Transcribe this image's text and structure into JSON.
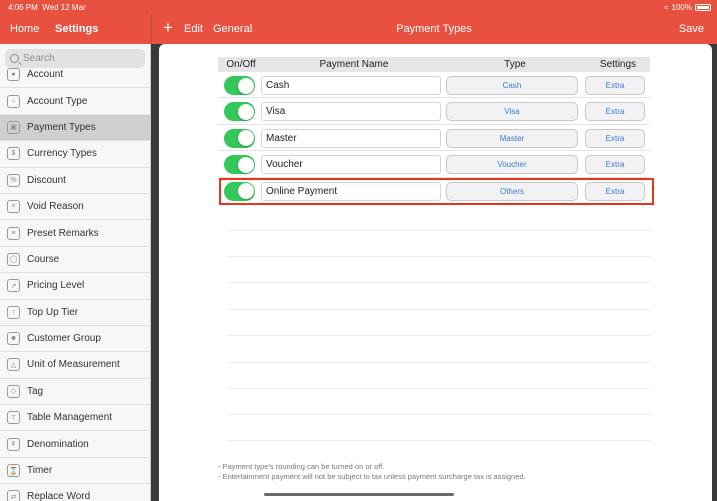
{
  "status": {
    "time": "4:06 PM",
    "date": "Wed 12 Mar",
    "battery": "100%"
  },
  "nav": {
    "home": "Home",
    "settings": "Settings",
    "add_icon": "+",
    "edit": "Edit",
    "general": "General",
    "title": "Payment Types",
    "save": "Save"
  },
  "sidebar": {
    "search_placeholder": "Search",
    "items": [
      {
        "label": "Account",
        "icon": "user-icon"
      },
      {
        "label": "Account Type",
        "icon": "account-type-icon"
      },
      {
        "label": "Payment Types",
        "icon": "wallet-icon",
        "active": true
      },
      {
        "label": "Currency Types",
        "icon": "currency-icon"
      },
      {
        "label": "Discount",
        "icon": "percent-icon"
      },
      {
        "label": "Void Reason",
        "icon": "void-icon"
      },
      {
        "label": "Preset Remarks",
        "icon": "list-icon"
      },
      {
        "label": "Course",
        "icon": "course-icon"
      },
      {
        "label": "Pricing Level",
        "icon": "price-tag-icon"
      },
      {
        "label": "Top Up Tier",
        "icon": "top-up-icon"
      },
      {
        "label": "Customer Group",
        "icon": "group-icon"
      },
      {
        "label": "Unit of Measurement",
        "icon": "measure-icon"
      },
      {
        "label": "Tag",
        "icon": "tag-icon"
      },
      {
        "label": "Table Management",
        "icon": "table-icon"
      },
      {
        "label": "Denomination",
        "icon": "coin-icon"
      },
      {
        "label": "Timer",
        "icon": "hourglass-icon"
      },
      {
        "label": "Replace Word",
        "icon": "replace-icon"
      }
    ]
  },
  "table": {
    "headers": {
      "onoff": "On/Off",
      "name": "Payment Name",
      "type": "Type",
      "settings": "Settings"
    },
    "rows": [
      {
        "name": "Cash",
        "type": "Cash",
        "extra": "Extra",
        "enabled": true
      },
      {
        "name": "Visa",
        "type": "Visa",
        "extra": "Extra",
        "enabled": true
      },
      {
        "name": "Master",
        "type": "Master",
        "extra": "Extra",
        "enabled": true
      },
      {
        "name": "Voucher",
        "type": "Voucher",
        "extra": "Extra",
        "enabled": true
      },
      {
        "name": "Online Payment",
        "type": "Others",
        "extra": "Extra",
        "enabled": true,
        "highlighted": true
      }
    ]
  },
  "footnotes": [
    "- Payment type's rounding can be turned on or off.",
    "- Entertainment payment will not be subject to tax unless payment surcharge tax is assigned."
  ],
  "colors": {
    "accent": "#e8503f",
    "toggle_on": "#34c759",
    "link": "#3a7bd5",
    "highlight": "#e8361d"
  }
}
